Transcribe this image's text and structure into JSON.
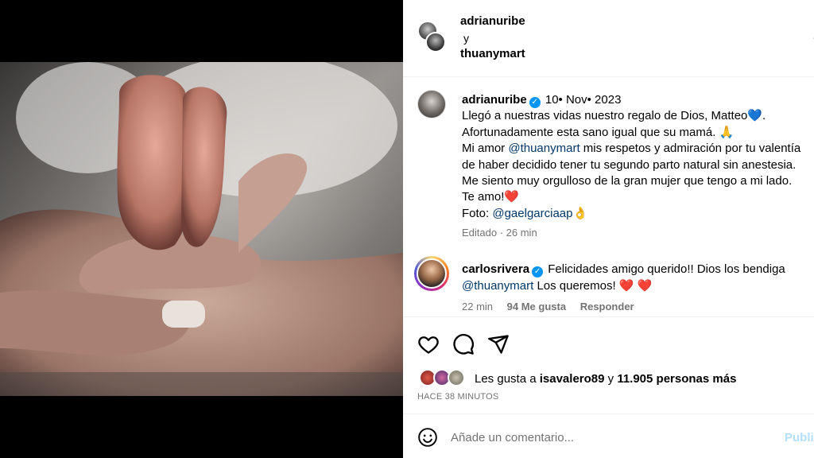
{
  "header": {
    "user1": "adrianuribe",
    "connector": "y",
    "user2": "thuanymart"
  },
  "caption": {
    "username": "adrianuribe",
    "date": "10• Nov• 2023",
    "lines": [
      "Llegó a nuestras vidas nuestro regalo de Dios, Matteo💙.",
      "Afortunadamente esta sano igual que su mamá. 🙏",
      "mis respetos y admiración por tu valentía",
      "de haber decidido tener tu segundo parto natural sin anestesia.",
      "Me siento muy orgulloso de la gran mujer que tengo a mi lado.",
      "Te amo!❤️"
    ],
    "line3_prefix": "Mi amor",
    "mention1": "@thuanymart",
    "photo_label": "Foto:",
    "photo_credit": "@gaelgarciaap👌",
    "edited": "Editado",
    "edited_time": "26 min"
  },
  "comment": {
    "username": "carlosrivera",
    "text1": "Felicidades amigo querido!! Dios los bendiga",
    "mention": "@thuanymart",
    "text2": "Los queremos! ❤️ ❤️",
    "time": "22 min",
    "likes": "94 Me gusta",
    "reply": "Responder"
  },
  "actions": {
    "like_icon": "heart-icon",
    "comment_icon": "comment-icon",
    "share_icon": "send-icon"
  },
  "likes": {
    "prefix": "Les gusta a",
    "user": "isavalero89",
    "middle": "y",
    "count": "11.905 personas más"
  },
  "timeago": "HACE 38 MINUTOS",
  "add_comment": {
    "placeholder": "Añade un comentario...",
    "publish": "Publi"
  },
  "colors": {
    "link": "#00376b",
    "verified": "#0095f6",
    "muted": "#737373",
    "publish_disabled": "#b2dffc"
  }
}
